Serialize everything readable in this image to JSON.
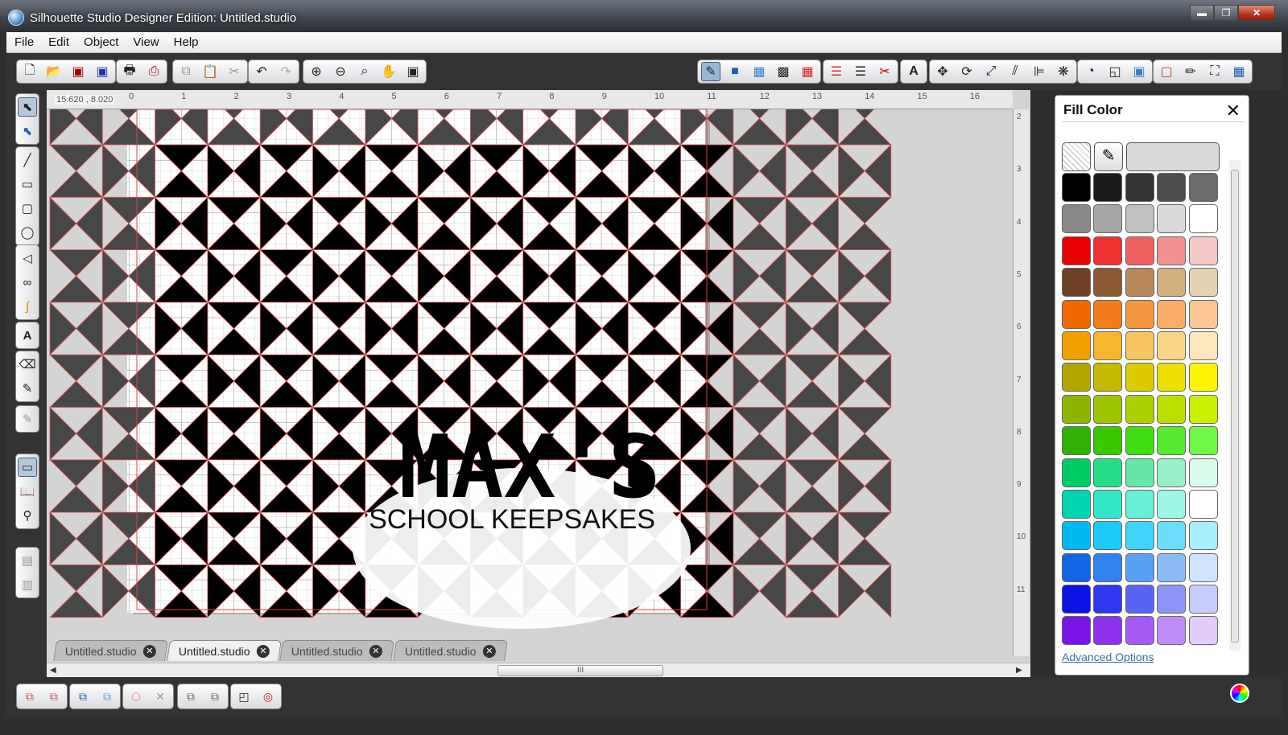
{
  "window": {
    "title": "Silhouette Studio Designer Edition: Untitled.studio",
    "min": "▬",
    "max": "❐",
    "close": "✕"
  },
  "menu": [
    "File",
    "Edit",
    "Object",
    "View",
    "Help"
  ],
  "canvas": {
    "coord": "15.620 , 8.020",
    "ruler_h": [
      "0",
      "1",
      "2",
      "3",
      "4",
      "5",
      "6",
      "7",
      "8",
      "9",
      "10",
      "11",
      "12",
      "13",
      "14",
      "15",
      "16"
    ],
    "ruler_v": [
      "2",
      "3",
      "4",
      "5",
      "6",
      "7",
      "8",
      "9",
      "10",
      "11"
    ],
    "text_main": "MAX'S",
    "text_sub": "SCHOOL KEEPSAKES",
    "scroll_grip": "III"
  },
  "tabs": [
    {
      "label": "Untitled.studio",
      "active": false
    },
    {
      "label": "Untitled.studio",
      "active": true
    },
    {
      "label": "Untitled.studio",
      "active": false
    },
    {
      "label": "Untitled.studio",
      "active": false
    }
  ],
  "fill_panel": {
    "title": "Fill Color",
    "advanced": "Advanced Options",
    "swatches": [
      [
        "#000000",
        "#1c1c1c",
        "#333333",
        "#4d4d4d",
        "#6b6b6b"
      ],
      [
        "#888888",
        "#a6a6a6",
        "#c0c0c0",
        "#d9d9d9",
        "#ffffff"
      ],
      [
        "#e60000",
        "#ef3030",
        "#f06060",
        "#f39090",
        "#f7c8c8"
      ],
      [
        "#6e4026",
        "#8b5a32",
        "#b8875a",
        "#d4b080",
        "#e6d2b0"
      ],
      [
        "#ee6a00",
        "#f37d1a",
        "#f59640",
        "#f8ac68",
        "#fac795"
      ],
      [
        "#f2a000",
        "#f6b630",
        "#f7c560",
        "#f9d489",
        "#fce7c0"
      ],
      [
        "#b3a400",
        "#c7b800",
        "#dccb00",
        "#ede000",
        "#fff500"
      ],
      [
        "#8db400",
        "#9cc500",
        "#acd100",
        "#bbe000",
        "#c9f000"
      ],
      [
        "#30b000",
        "#38c800",
        "#42dd10",
        "#55ea30",
        "#6ef745"
      ],
      [
        "#00cc66",
        "#25dd88",
        "#66e6a8",
        "#99f0c8",
        "#d8fbeb"
      ],
      [
        "#00d4b0",
        "#33e6c8",
        "#66f0d8",
        "#a0f6e6",
        "#ffffff"
      ],
      [
        "#00b8f0",
        "#1ccaf8",
        "#40d4fa",
        "#6cdefc",
        "#a8eefe"
      ],
      [
        "#1464e6",
        "#3282f0",
        "#5aa0f4",
        "#8cbcf8",
        "#d0e2fc"
      ],
      [
        "#0a14e6",
        "#2e38f0",
        "#5a64f4",
        "#8c94f8",
        "#c8ccfc"
      ],
      [
        "#7a14e6",
        "#8e32f0",
        "#a45af4",
        "#c08cf8",
        "#e2ccfc"
      ]
    ]
  }
}
